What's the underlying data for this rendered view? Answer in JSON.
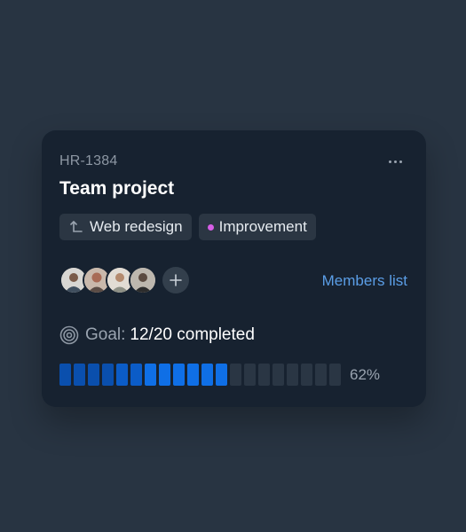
{
  "card": {
    "issue_key": "HR-1384",
    "title": "Team project",
    "more_icon": "more-horizontal-icon",
    "tags": [
      {
        "label": "Web redesign",
        "icon": "branch-arrow-icon"
      },
      {
        "label": "Improvement",
        "dot_color": "#d65ee6"
      }
    ],
    "members": {
      "avatars": [
        "member-1",
        "member-2",
        "member-3",
        "member-4"
      ],
      "add_icon": "plus-icon",
      "link_label": "Members list"
    },
    "goal": {
      "icon": "target-icon",
      "label": "Goal:",
      "value": "12/20 completed",
      "completed": 12,
      "total": 20,
      "percent_label": "62%"
    }
  },
  "colors": {
    "page_bg": "#283442",
    "card_bg": "#172230",
    "accent": "#5b9ee6",
    "progress_filled_dark": "#0a4fad",
    "progress_filled_light": "#0f6fe6",
    "progress_empty": "#2a3644",
    "tag_bg": "#2b3643"
  }
}
